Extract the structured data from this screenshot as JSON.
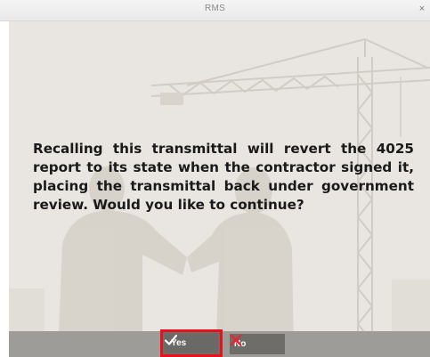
{
  "window": {
    "title": "RMS",
    "close_glyph": "×"
  },
  "dialog": {
    "message": "Recalling this transmittal will revert the 4025 report to its state when the contractor signed it, placing the transmittal back under government review. Would you like to continue?",
    "background_image": "construction-crane-handshake-silhouette"
  },
  "buttons": {
    "yes_label": "Yes",
    "no_label": "No",
    "yes_icon": "checkmark-icon",
    "no_icon": "x-icon",
    "highlight_color": "#e8101a"
  },
  "colors": {
    "button_bar": "#9d9c99",
    "button_face": "#6e6d6a",
    "no_icon_color": "#e8262d"
  }
}
